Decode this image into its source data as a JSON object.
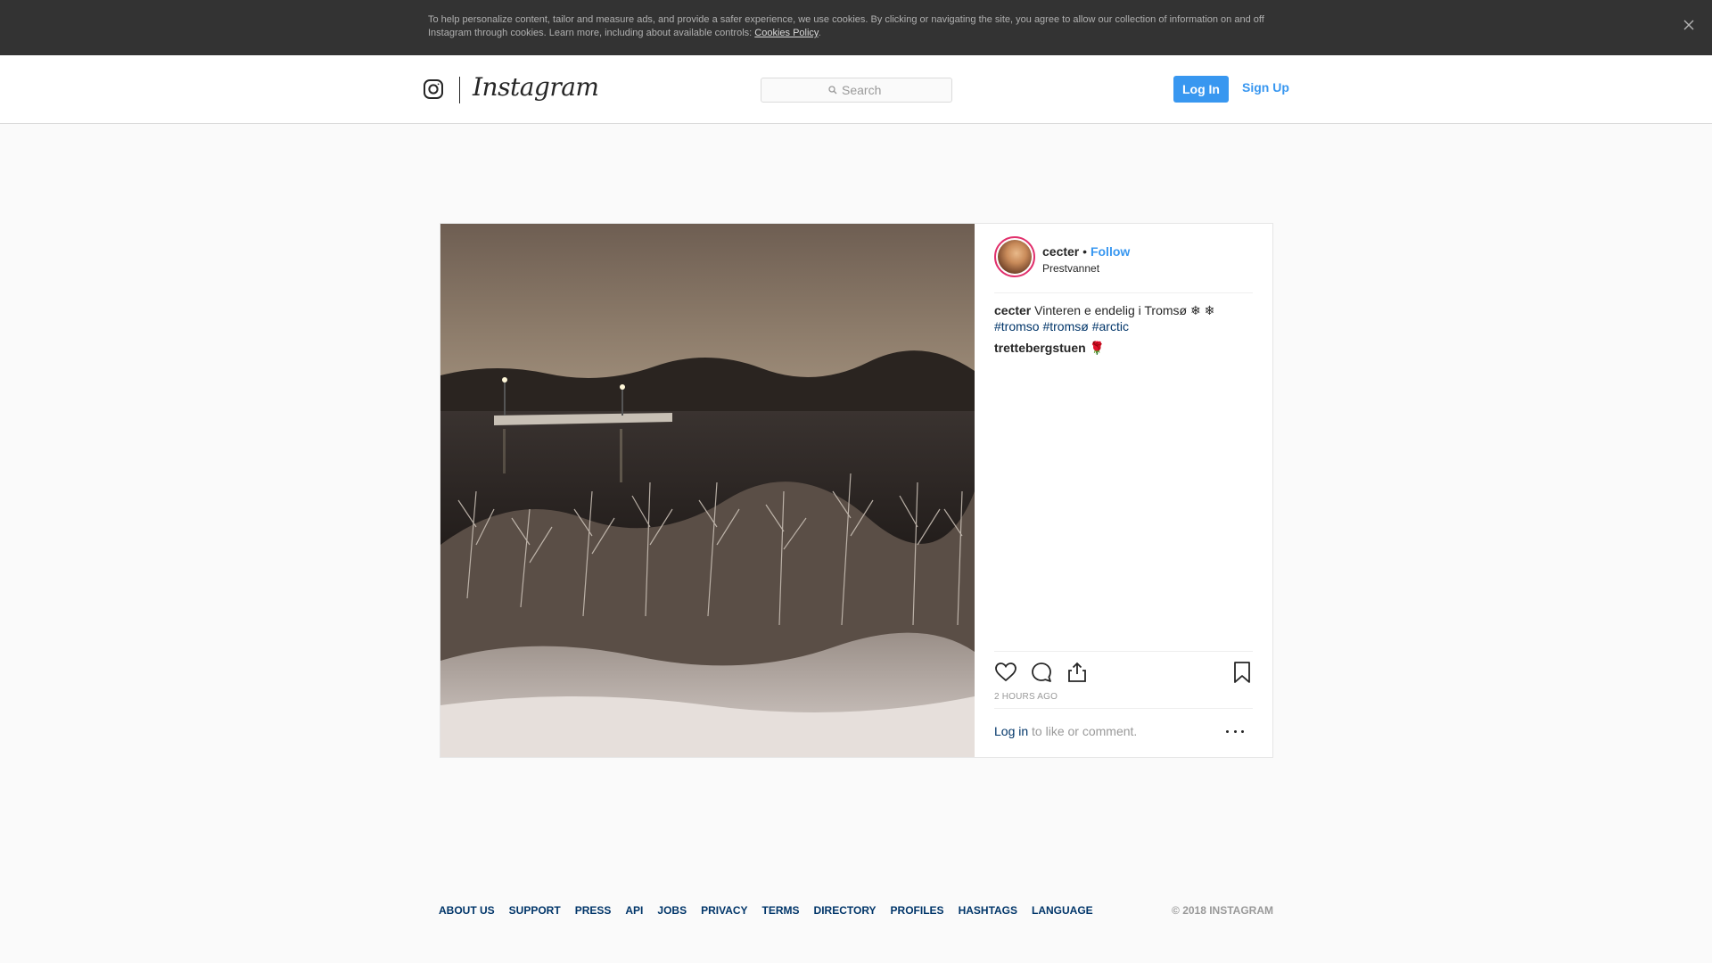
{
  "cookie_banner": {
    "text": "To help personalize content, tailor and measure ads, and provide a safer experience, we use cookies. By clicking or navigating the site, you agree to allow our collection of information on and off Instagram through cookies. Learn more, including about available controls: ",
    "link": "Cookies Policy",
    "suffix": ".",
    "close_icon": "close-icon"
  },
  "header": {
    "logo_icon": "camera-glyph-icon",
    "logo_text": "Instagram",
    "search": {
      "placeholder": "Search",
      "value": "",
      "icon": "search-icon"
    },
    "login_label": "Log In",
    "signup_label": "Sign Up"
  },
  "post": {
    "owner": {
      "username": "cecter",
      "separator": " • ",
      "follow_label": "Follow",
      "location": "Prestvannet"
    },
    "caption": {
      "username": "cecter",
      "text": "Vinteren e endelig i Tromsø ❄ ❄",
      "hashtags": [
        "#tromso",
        "#tromsø",
        "#arctic"
      ]
    },
    "comment": "trettebergstuen 🌹",
    "actions": {
      "like_icon": "heart-icon",
      "comment_icon": "comment-bubble-icon",
      "share_icon": "share-icon",
      "save_icon": "bookmark-icon"
    },
    "timestamp": "2 HOURS AGO",
    "comment_prompt": {
      "link": "Log in",
      "text": " to like or comment."
    },
    "more_icon": "more-options-icon"
  },
  "footer": {
    "links": [
      "ABOUT US",
      "SUPPORT",
      "PRESS",
      "API",
      "JOBS",
      "PRIVACY",
      "TERMS",
      "DIRECTORY",
      "PROFILES",
      "HASHTAGS",
      "LANGUAGE"
    ],
    "copyright": "© 2018 INSTAGRAM"
  },
  "colors": {
    "accent": "#3897f0",
    "link_dark": "#003569",
    "banner_bg": "#333333"
  }
}
